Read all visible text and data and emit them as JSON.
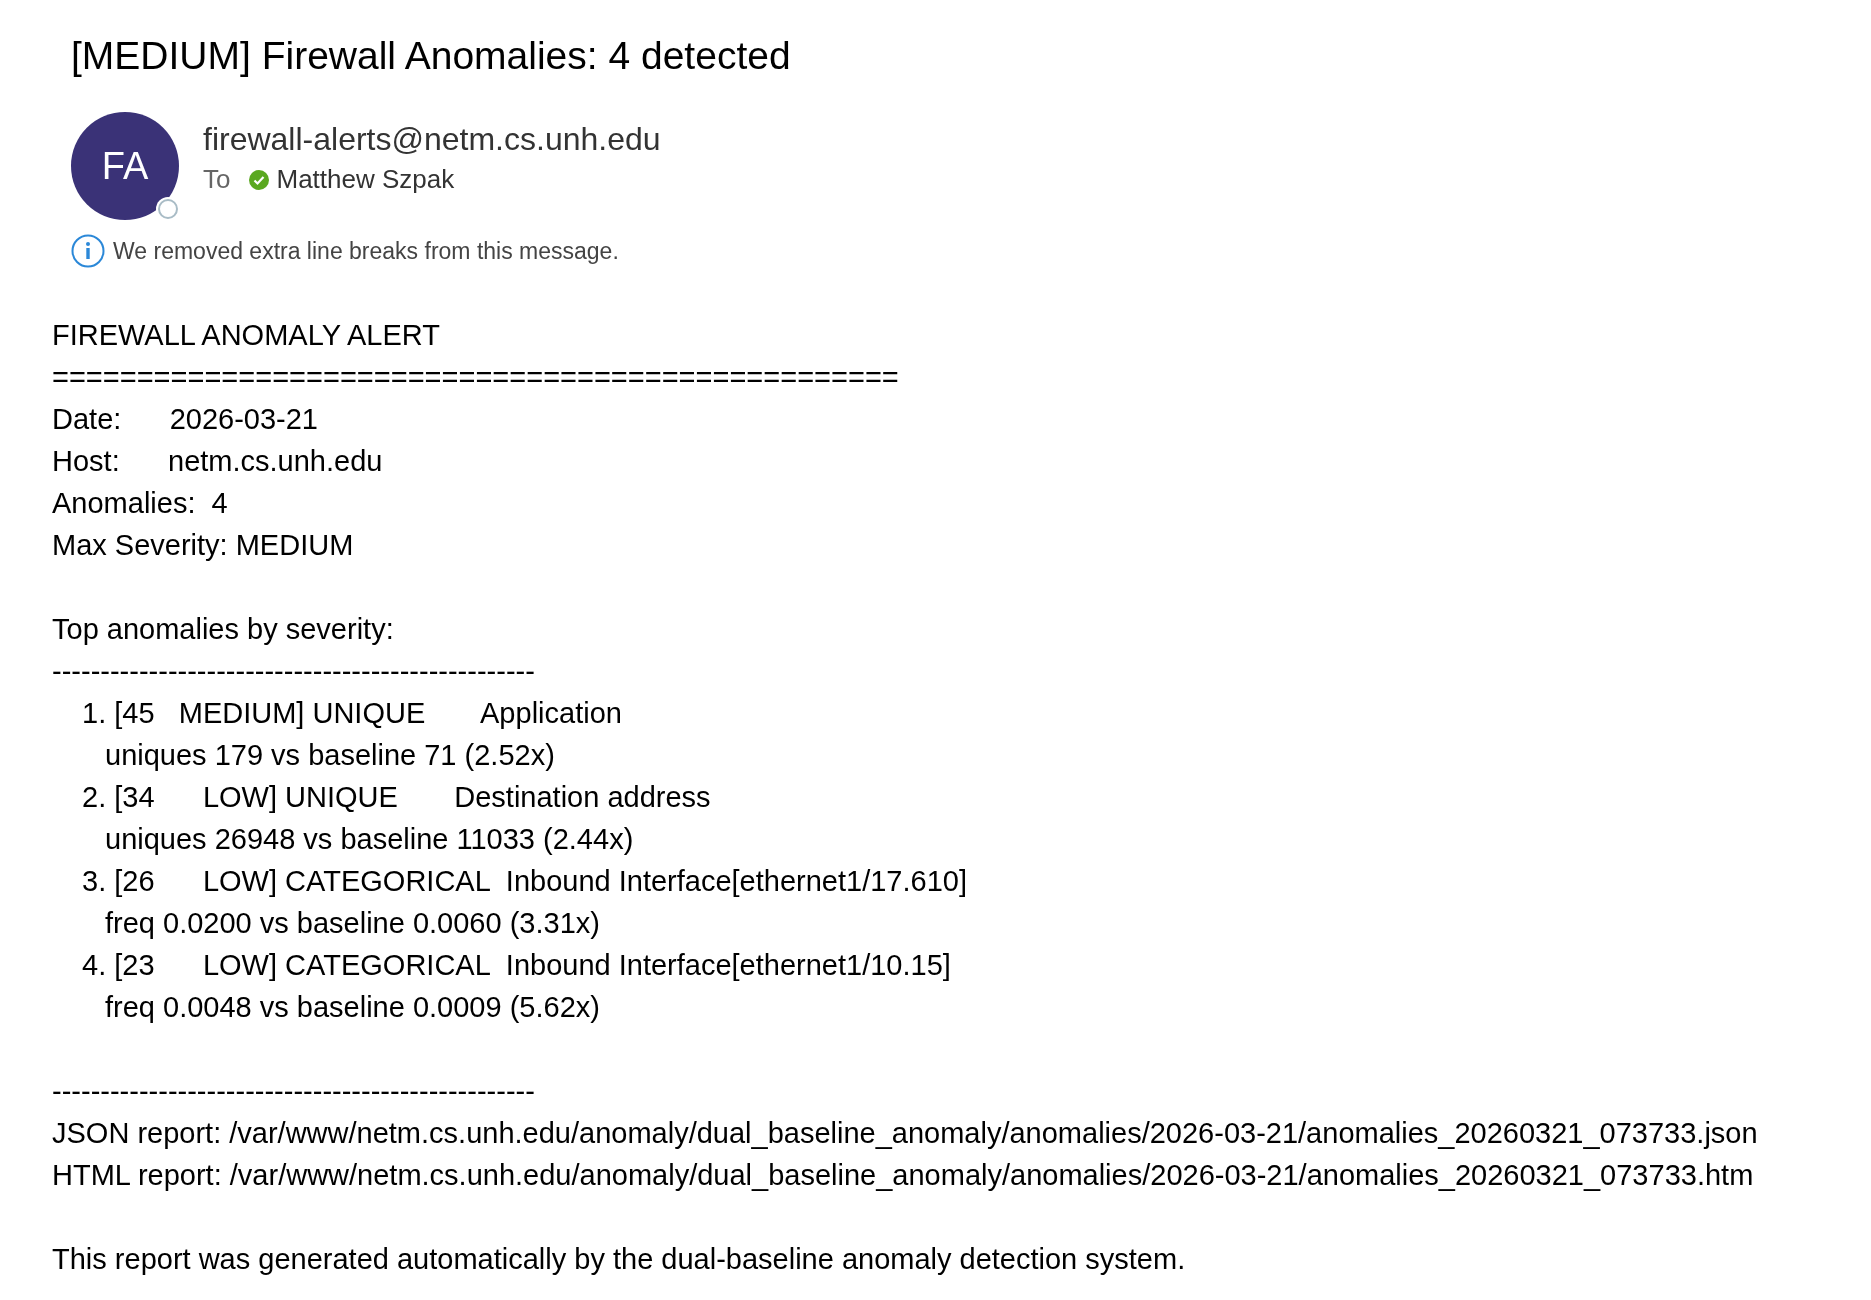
{
  "subject": "[MEDIUM] Firewall Anomalies: 4 detected",
  "sender": {
    "initials": "FA",
    "address": "firewall-alerts@netm.cs.unh.edu"
  },
  "to_label": "To",
  "recipients": [
    {
      "name": "Matthew Szpak",
      "verified": true
    }
  ],
  "notice": "We removed extra line breaks from this message.",
  "body": {
    "heading": "FIREWALL ANOMALY ALERT",
    "rule_top": "==================================================",
    "fields": [
      "Date:      2026-03-21",
      "Host:      netm.cs.unh.edu",
      "Anomalies:  4",
      "Max Severity: MEDIUM"
    ],
    "list_heading": "Top anomalies by severity:",
    "rule_list": "--------------------------------------------------",
    "anomalies": [
      {
        "headline": "1. [45   MEDIUM] UNIQUE       Application",
        "detail": "uniques 179 vs baseline 71 (2.52x)"
      },
      {
        "headline": "2. [34      LOW] UNIQUE       Destination address",
        "detail": "uniques 26948 vs baseline 11033 (2.44x)"
      },
      {
        "headline": "3. [26      LOW] CATEGORICAL  Inbound Interface[ethernet1/17.610]",
        "detail": "freq 0.0200 vs baseline 0.0060 (3.31x)"
      },
      {
        "headline": "4. [23      LOW] CATEGORICAL  Inbound Interface[ethernet1/10.15]",
        "detail": "freq 0.0048 vs baseline 0.0009 (5.62x)"
      }
    ],
    "rule_bottom": "--------------------------------------------------",
    "reports": [
      "JSON report: /var/www/netm.cs.unh.edu/anomaly/dual_baseline_anomaly/anomalies/2026-03-21/anomalies_20260321_073733.json",
      "HTML report: /var/www/netm.cs.unh.edu/anomaly/dual_baseline_anomaly/anomalies/2026-03-21/anomalies_20260321_073733.htm"
    ],
    "footer": "This report was generated automatically by the dual-baseline anomaly detection system."
  }
}
